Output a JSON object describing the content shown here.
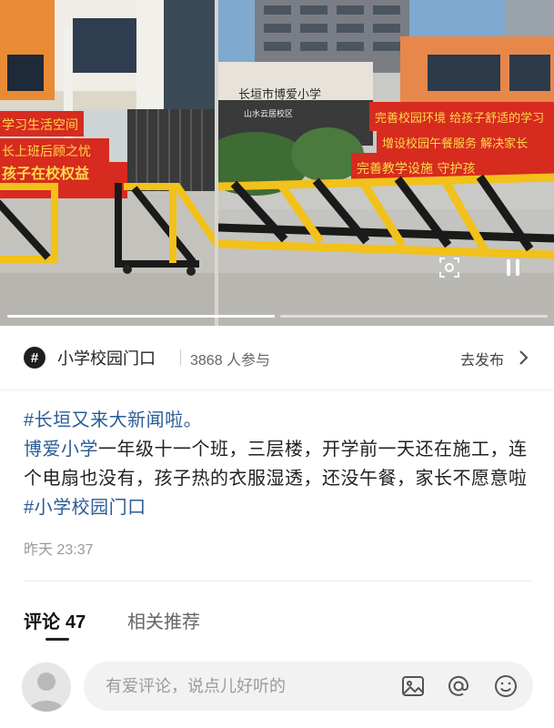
{
  "media": {
    "left_photo": {
      "banner_lines": [
        "学习生活空间",
        "长上班后顾之忧",
        "孩子在校权益"
      ]
    },
    "right_photo": {
      "school_sign": "长垣市博爱小学",
      "campus_sign": "山水云居校区",
      "banner_lines": [
        "完善校园环境 给孩子舒适的学习",
        "增设校园午餐服务 解决家长",
        "完善教学设施 守护孩"
      ]
    },
    "icons": {
      "scan": "scan-icon",
      "pause": "pause-icon"
    },
    "pager": {
      "pages": 2,
      "active": 1
    }
  },
  "topic": {
    "icon": "hash-topic-icon",
    "name": "小学校园门口",
    "count": "3868 人参与",
    "post_link": "去发布",
    "chevron": "chevron-right-icon"
  },
  "post": {
    "hashtag_line": "#长垣又来大新闻啦。",
    "mention": "博爱小学",
    "body": "一年级十一个班，三层楼，开学前一天还在施工，连个电扇也没有，孩子热的衣服湿透，还没午餐，家长不愿意啦",
    "tail_hashtag": "#小学校园门口",
    "timestamp": "昨天 23:37"
  },
  "tabs": {
    "comments_label": "评论",
    "comments_count": "47",
    "related_label": "相关推荐"
  },
  "comment_bar": {
    "placeholder": "有爱评论，说点儿好听的",
    "icons": [
      "image-icon",
      "at-icon",
      "emoji-icon"
    ]
  },
  "colors": {
    "link_blue": "#2a5c96",
    "banner_red": "#d72b1f",
    "banner_text": "#ffd94a",
    "barrier_yellow": "#f2c11a"
  }
}
